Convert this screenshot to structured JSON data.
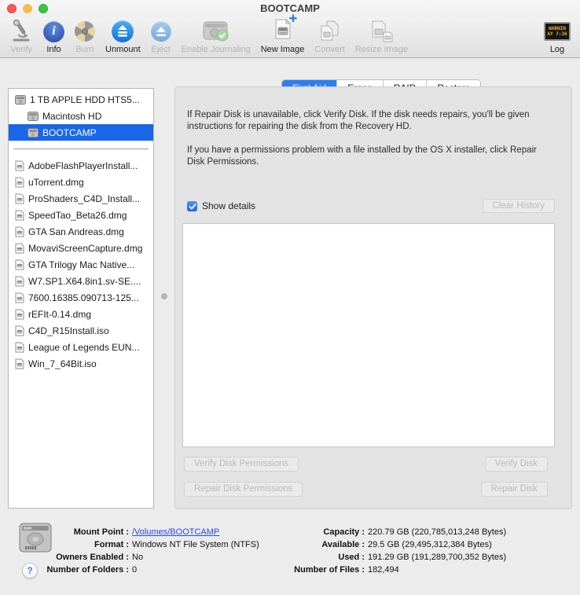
{
  "window": {
    "title": "BOOTCAMP"
  },
  "toolbar": {
    "items": [
      {
        "id": "verify",
        "label": "Verify",
        "icon": "microscope",
        "enabled": false
      },
      {
        "id": "info",
        "label": "Info",
        "icon": "info",
        "enabled": true
      },
      {
        "id": "burn",
        "label": "Burn",
        "icon": "burn",
        "enabled": false
      },
      {
        "id": "unmount",
        "label": "Unmount",
        "icon": "unmount",
        "enabled": true
      },
      {
        "id": "eject",
        "label": "Eject",
        "icon": "eject",
        "enabled": false
      },
      {
        "id": "enable-journaling",
        "label": "Enable Journaling",
        "icon": "journal",
        "enabled": false
      },
      {
        "id": "new-image",
        "label": "New Image",
        "icon": "new-image",
        "enabled": true
      },
      {
        "id": "convert",
        "label": "Convert",
        "icon": "convert",
        "enabled": false
      },
      {
        "id": "resize-image",
        "label": "Resize Image",
        "icon": "resize",
        "enabled": false
      },
      {
        "id": "log",
        "label": "Log",
        "icon": "log",
        "enabled": true
      }
    ]
  },
  "log_icon_text": [
    "WARNIN",
    "AY 7:36"
  ],
  "sidebar": {
    "devices": [
      {
        "label": "1 TB APPLE HDD HTS5...",
        "level": 0,
        "selected": false
      },
      {
        "label": "Macintosh HD",
        "level": 1,
        "selected": false
      },
      {
        "label": "BOOTCAMP",
        "level": 1,
        "selected": true
      }
    ],
    "images": [
      "AdobeFlashPlayerInstall...",
      "uTorrent.dmg",
      "ProShaders_C4D_Install...",
      "SpeedTao_Beta26.dmg",
      "GTA San Andreas.dmg",
      "MovaviScreenCapture.dmg",
      "GTA Trilogy Mac Native...",
      "W7.SP1.X64.8in1.sv-SE....",
      "7600.16385.090713-125...",
      "rEFIt-0.14.dmg",
      "C4D_R15Install.iso",
      "League of Legends EUN...",
      "Win_7_64Bit.iso"
    ]
  },
  "tabs": {
    "items": [
      "First Aid",
      "Erase",
      "RAID",
      "Restore"
    ],
    "selected": 0
  },
  "first_aid": {
    "paragraphs": [
      "If Repair Disk is unavailable, click Verify Disk. If the disk needs repairs, you'll be given instructions for repairing the disk from the Recovery HD.",
      "If you have a permissions problem with a file installed by the OS X installer, click Repair Disk Permissions."
    ],
    "show_details": {
      "label": "Show details",
      "checked": true
    },
    "clear_history": "Clear History",
    "verify_permissions": "Verify Disk Permissions",
    "verify_disk": "Verify Disk",
    "repair_permissions": "Repair Disk Permissions",
    "repair_disk": "Repair Disk"
  },
  "footer": {
    "left": [
      {
        "label": "Mount Point",
        "value": "/Volumes/BOOTCAMP",
        "link": true
      },
      {
        "label": "Format",
        "value": "Windows NT File System (NTFS)"
      },
      {
        "label": "Owners Enabled",
        "value": "No"
      },
      {
        "label": "Number of Folders",
        "value": "0"
      }
    ],
    "right": [
      {
        "label": "Capacity",
        "value": "220.79 GB (220,785,013,248 Bytes)"
      },
      {
        "label": "Available",
        "value": "29.5 GB (29,495,312,384 Bytes)"
      },
      {
        "label": "Used",
        "value": "191.29 GB (191,289,700,352 Bytes)"
      },
      {
        "label": "Number of Files",
        "value": "182,494"
      }
    ]
  },
  "colors": {
    "selection_blue": "#1a66e8",
    "tab_blue": "#2c7ef2",
    "link_blue": "#2b46f0",
    "checkbox_blue": "#2e7bf6",
    "traffic_red": "#f45b57",
    "traffic_yellow": "#f5bd4f",
    "traffic_green": "#3cc53f"
  }
}
